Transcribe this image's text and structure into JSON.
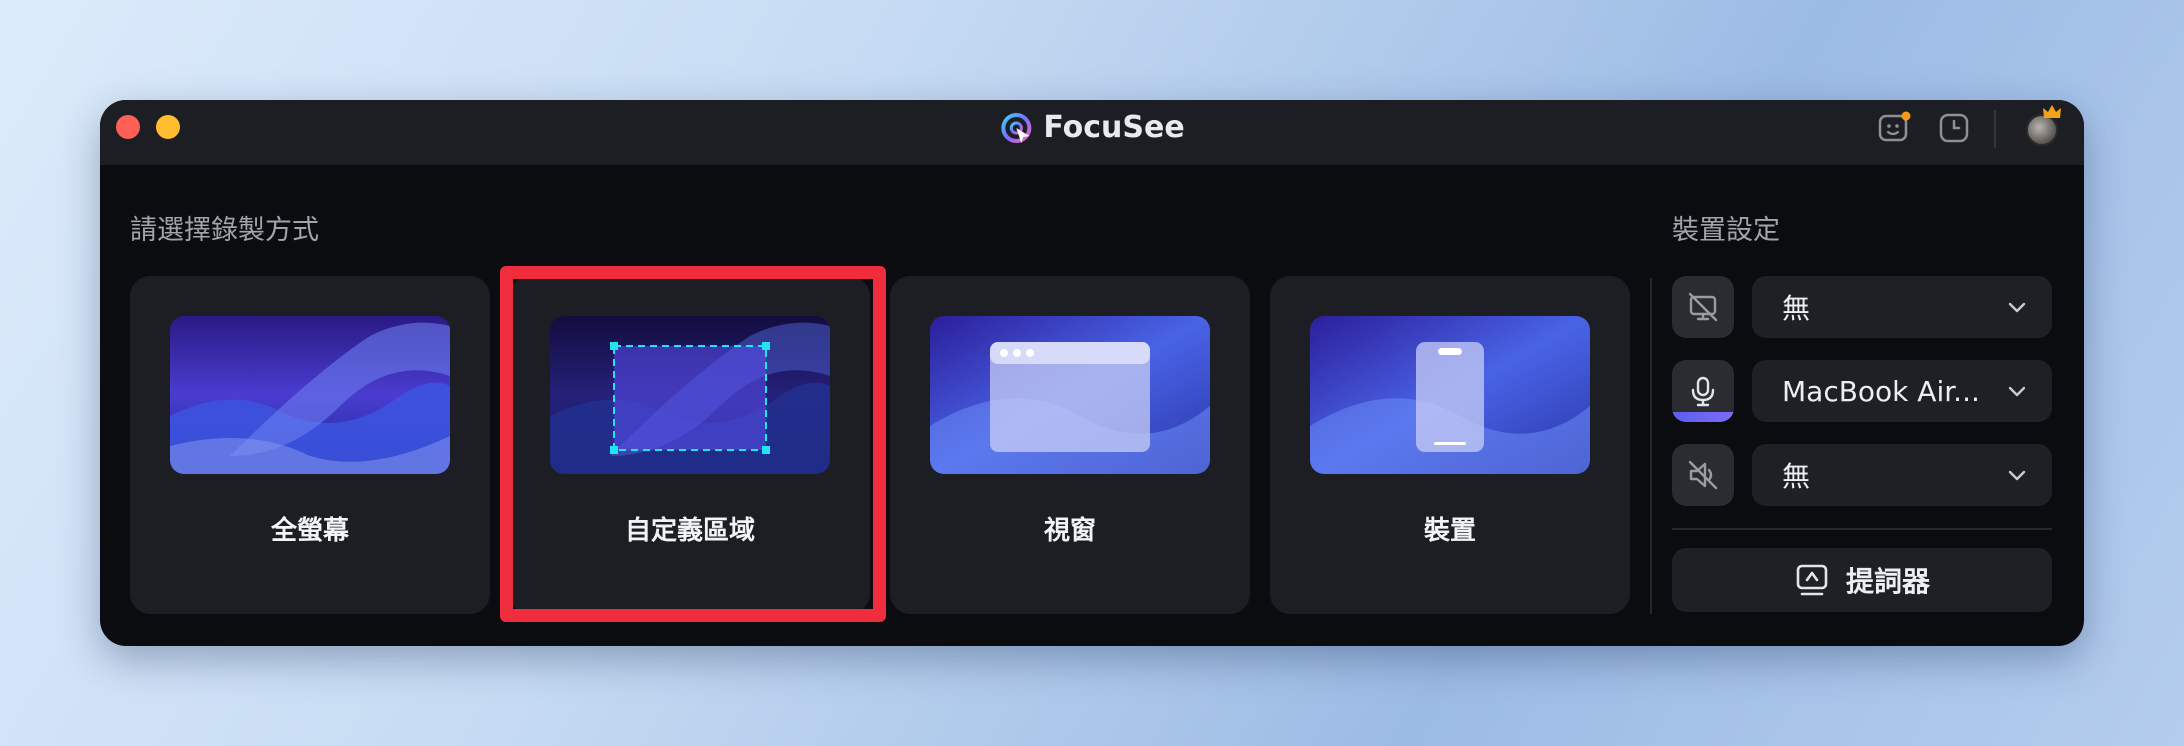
{
  "app": {
    "title": "FocuSee"
  },
  "recording": {
    "section_label": "請選擇錄製方式",
    "modes": [
      {
        "label": "全螢幕",
        "selected": false
      },
      {
        "label": "自定義區域",
        "selected": true
      },
      {
        "label": "視窗",
        "selected": false
      },
      {
        "label": "裝置",
        "selected": false
      }
    ]
  },
  "device_settings": {
    "section_label": "裝置設定",
    "camera": {
      "icon": "camera-off-icon",
      "value": "無"
    },
    "microphone": {
      "icon": "microphone-icon",
      "value": "MacBook Air...",
      "level": 0.3
    },
    "system_audio": {
      "icon": "speaker-off-icon",
      "value": "無"
    },
    "teleprompter_label": "提詞器"
  },
  "colors": {
    "window_bg": "#0b0c0f",
    "card_bg": "#1d1e23",
    "highlight": "#ef2d3c",
    "accent": "#5b5ef0",
    "selection_dash": "#22e4f0"
  }
}
